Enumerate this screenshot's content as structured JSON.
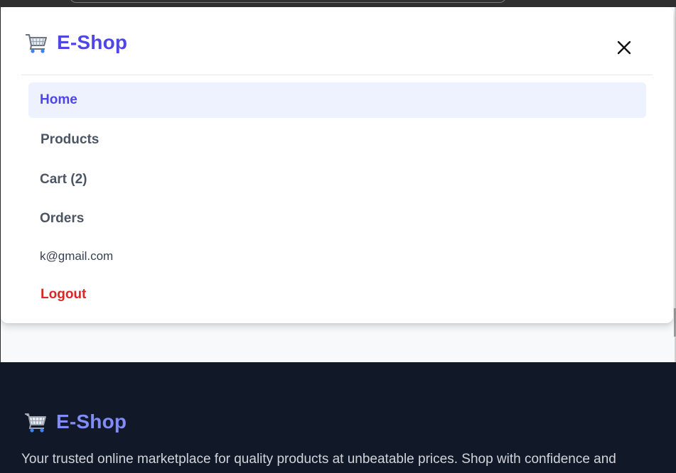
{
  "header": {
    "brand_name": "E-Shop",
    "logo_icon": "shopping-cart-icon",
    "close_icon": "close-icon"
  },
  "nav": {
    "items": [
      {
        "label": "Home",
        "active": true
      },
      {
        "label": "Products"
      },
      {
        "label": "Cart (2)"
      },
      {
        "label": "Orders"
      }
    ],
    "user_email": "k@gmail.com",
    "logout_label": "Logout"
  },
  "footer": {
    "brand_name": "E-Shop",
    "tagline": "Your trusted online marketplace for quality products at unbeatable prices. Shop with confidence and"
  },
  "colors": {
    "accent": "#4f46e5",
    "active_bg": "#eef2ff",
    "logout": "#dc2626",
    "footer_bg": "#111827",
    "footer_brand": "#818cf8"
  }
}
